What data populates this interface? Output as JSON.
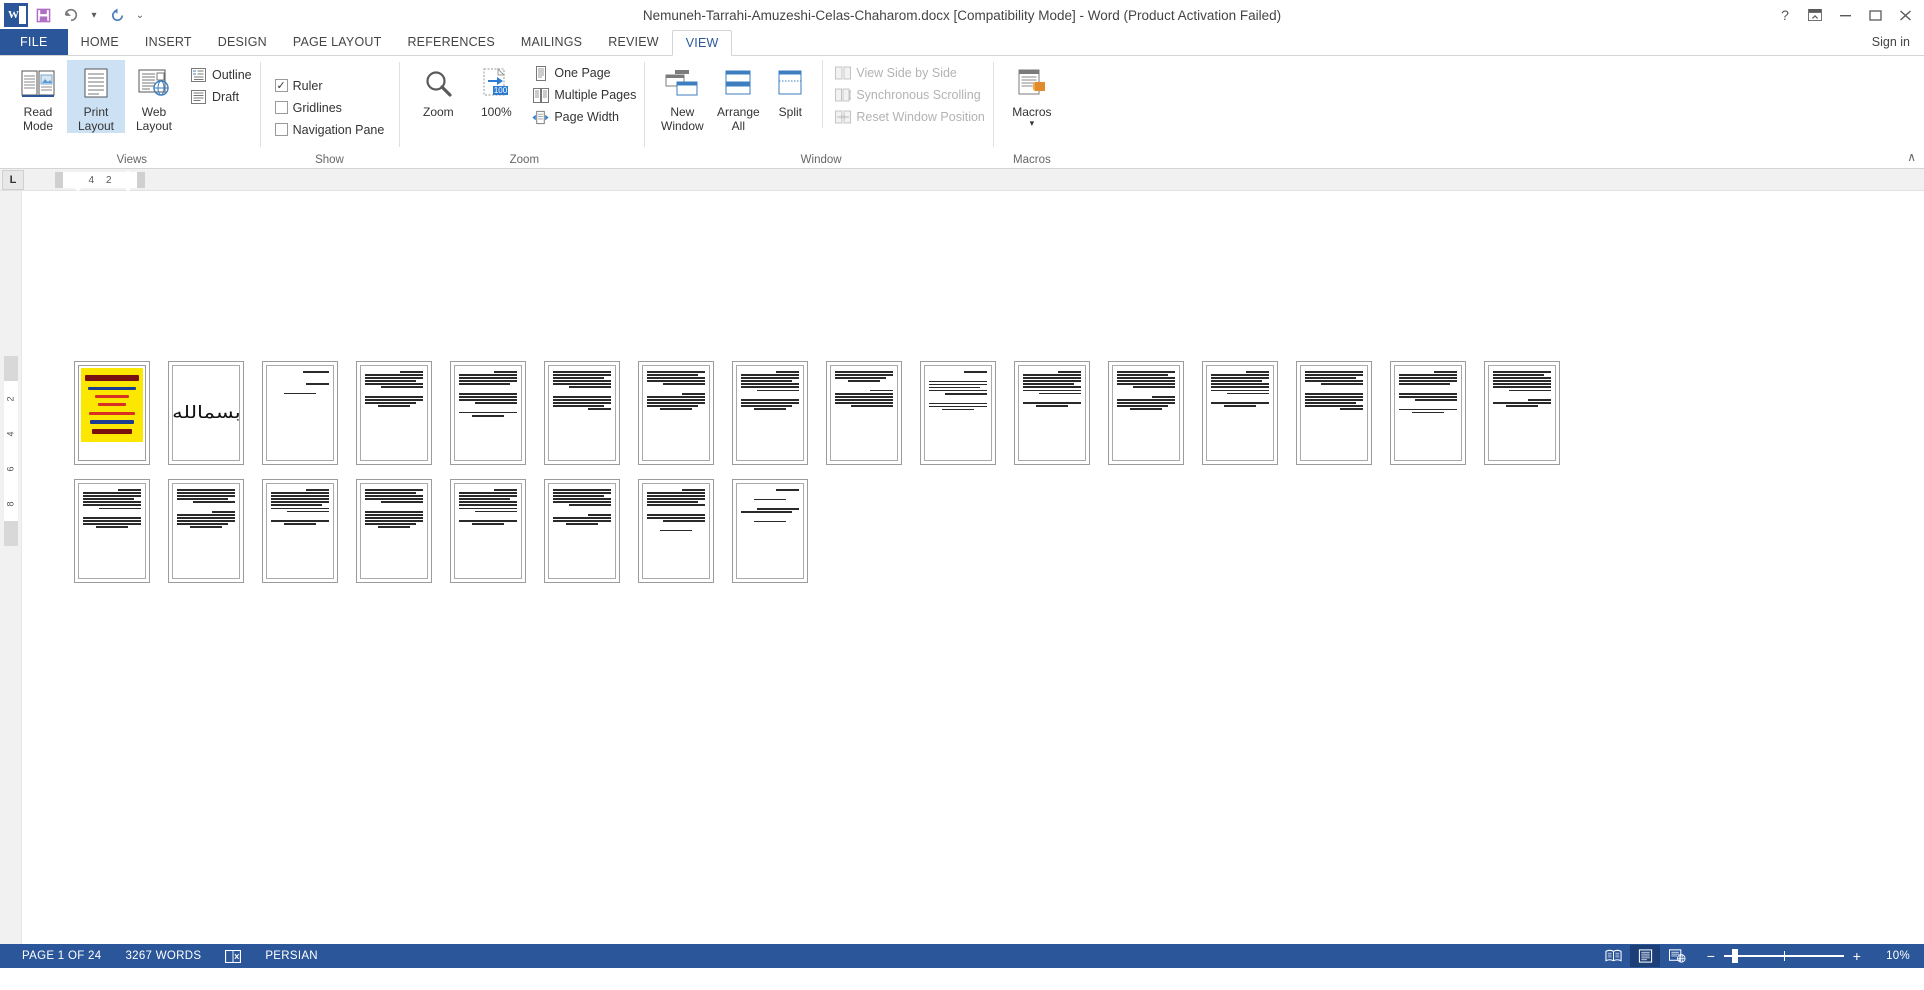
{
  "titlebar": {
    "app_icon": "word-logo-icon",
    "title": "Nemuneh-Tarrahi-Amuzeshi-Celas-Chaharom.docx [Compatibility Mode] - Word (Product Activation Failed)",
    "qat": [
      {
        "name": "save",
        "glyph": "■"
      },
      {
        "name": "undo",
        "glyph": "↶"
      },
      {
        "name": "redo",
        "glyph": "↻"
      },
      {
        "name": "customize-quick-access-toolbar",
        "glyph": "⌄"
      }
    ],
    "help_label": "?",
    "ribbon_display_label": "⇱",
    "minimize_label": "–",
    "restore_label": "❐",
    "close_label": "✕"
  },
  "tabs": {
    "file": "FILE",
    "items": [
      {
        "label": "HOME",
        "active": false
      },
      {
        "label": "INSERT",
        "active": false
      },
      {
        "label": "DESIGN",
        "active": false
      },
      {
        "label": "PAGE LAYOUT",
        "active": false
      },
      {
        "label": "REFERENCES",
        "active": false
      },
      {
        "label": "MAILINGS",
        "active": false
      },
      {
        "label": "REVIEW",
        "active": false
      },
      {
        "label": "VIEW",
        "active": true
      }
    ],
    "signin": "Sign in"
  },
  "ribbon": {
    "collapse_label": "∧",
    "groups": {
      "views": {
        "label": "Views",
        "read_mode": "Read\nMode",
        "read_mode_l1": "Read",
        "read_mode_l2": "Mode",
        "print_layout_l1": "Print",
        "print_layout_l2": "Layout",
        "web_layout_l1": "Web",
        "web_layout_l2": "Layout",
        "outline": "Outline",
        "draft": "Draft"
      },
      "show": {
        "label": "Show",
        "ruler": "Ruler",
        "ruler_checked": true,
        "gridlines": "Gridlines",
        "gridlines_checked": false,
        "navigation_pane": "Navigation Pane",
        "navigation_pane_checked": false
      },
      "zoom": {
        "label": "Zoom",
        "zoom": "Zoom",
        "one_hundred": "100%",
        "one_page": "One Page",
        "multiple_pages": "Multiple Pages",
        "page_width": "Page Width"
      },
      "window": {
        "label": "Window",
        "new_window_l1": "New",
        "new_window_l2": "Window",
        "arrange_all_l1": "Arrange",
        "arrange_all_l2": "All",
        "split": "Split",
        "view_side_by_side": "View Side by Side",
        "synchronous_scrolling": "Synchronous Scrolling",
        "reset_window_position": "Reset Window Position"
      },
      "macros": {
        "label": "Macros",
        "macros": "Macros",
        "dropdown": "▾"
      }
    }
  },
  "ruler": {
    "tab_selector": "L",
    "marks": [
      "4",
      "2"
    ],
    "vertical_marks": [
      "2",
      "4",
      "6",
      "8"
    ]
  },
  "document": {
    "zoom_percent": 10,
    "total_pages": 24,
    "pages": [
      {
        "n": 1,
        "type": "ad"
      },
      {
        "n": 2,
        "type": "bismillah"
      },
      {
        "n": 3,
        "type": "sparse"
      },
      {
        "n": 4,
        "type": "text"
      },
      {
        "n": 5,
        "type": "text"
      },
      {
        "n": 6,
        "type": "text"
      },
      {
        "n": 7,
        "type": "text"
      },
      {
        "n": 8,
        "type": "text"
      },
      {
        "n": 9,
        "type": "text"
      },
      {
        "n": 10,
        "type": "text"
      },
      {
        "n": 11,
        "type": "text"
      },
      {
        "n": 12,
        "type": "text"
      },
      {
        "n": 13,
        "type": "text"
      },
      {
        "n": 14,
        "type": "text"
      },
      {
        "n": 15,
        "type": "text"
      },
      {
        "n": 16,
        "type": "text"
      },
      {
        "n": 17,
        "type": "text"
      },
      {
        "n": 18,
        "type": "text"
      },
      {
        "n": 19,
        "type": "text"
      },
      {
        "n": 20,
        "type": "text"
      },
      {
        "n": 21,
        "type": "text"
      },
      {
        "n": 22,
        "type": "text"
      },
      {
        "n": 23,
        "type": "text"
      },
      {
        "n": 24,
        "type": "sparse"
      }
    ]
  },
  "statusbar": {
    "page_indicator": "PAGE 1 OF 24",
    "word_count": "3267 WORDS",
    "proofing_icon": "proofing-errors-icon",
    "language": "PERSIAN",
    "view_read_mode_icon": "read-mode-icon",
    "view_print_layout_icon": "print-layout-icon",
    "view_web_layout_icon": "web-layout-icon",
    "zoom_out": "−",
    "zoom_in": "+",
    "zoom_label": "10%"
  },
  "colors": {
    "accent": "#2b579a",
    "tab_active_text": "#2b579a",
    "selected_bg": "#cde1f5",
    "ad_yellow": "#fbe700",
    "ad_red": "#d93025"
  }
}
